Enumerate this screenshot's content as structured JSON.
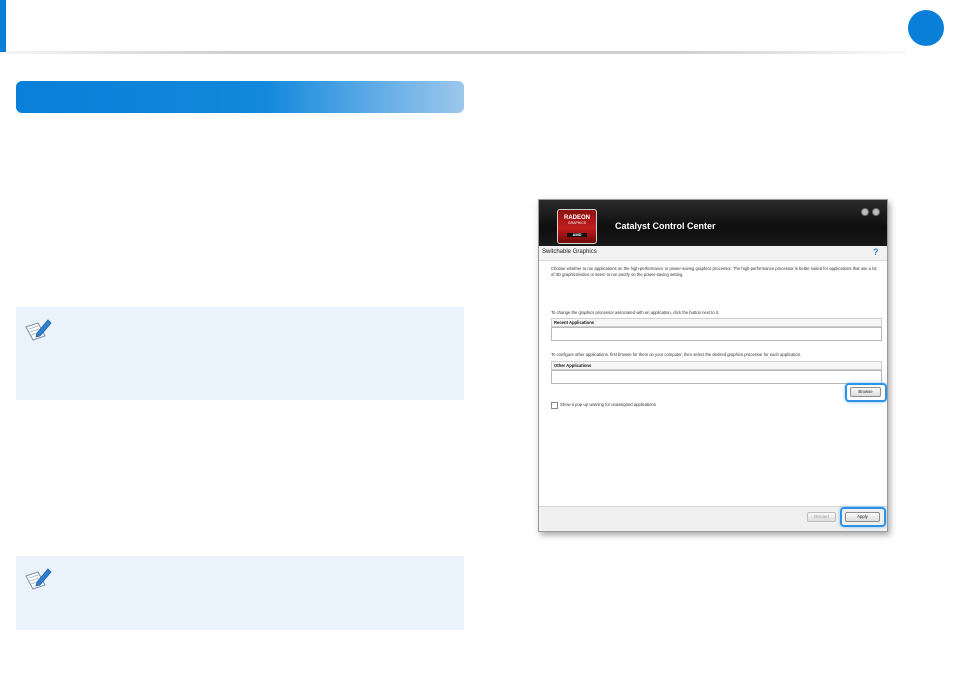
{
  "colors": {
    "accent": "#0a7fd8",
    "note_bg": "#eaf2fb",
    "highlight": "#2d93e8"
  },
  "icons": {
    "note": "pencil-note-icon",
    "help": "question-icon"
  },
  "window": {
    "title": "Catalyst Control Center",
    "logo": {
      "brand": "RADEON",
      "sub": "GRAPHICS",
      "vendor": "AMD"
    },
    "page_title": "Switchable Graphics",
    "help_glyph": "?",
    "description": "Choose whether to run applications on the high-performance or power-saving graphics processor. The high-performance processor is better suited for applications that use a lot of 3D graphics/video or seem to run poorly on the power-saving setting.",
    "change_instruction": "To change the graphics processor associated with an application, click the button next to it.",
    "recent_label": "Recent Applications",
    "configure_instruction": "To configure other applications, first browse for them on your computer, then select the desired graphics processor for each application.",
    "other_label": "Other Applications",
    "browse_label": "Browse",
    "checkbox_label": "Show a pop-up warning for unassigned applications",
    "discard_label": "Discard",
    "apply_label": "Apply"
  }
}
